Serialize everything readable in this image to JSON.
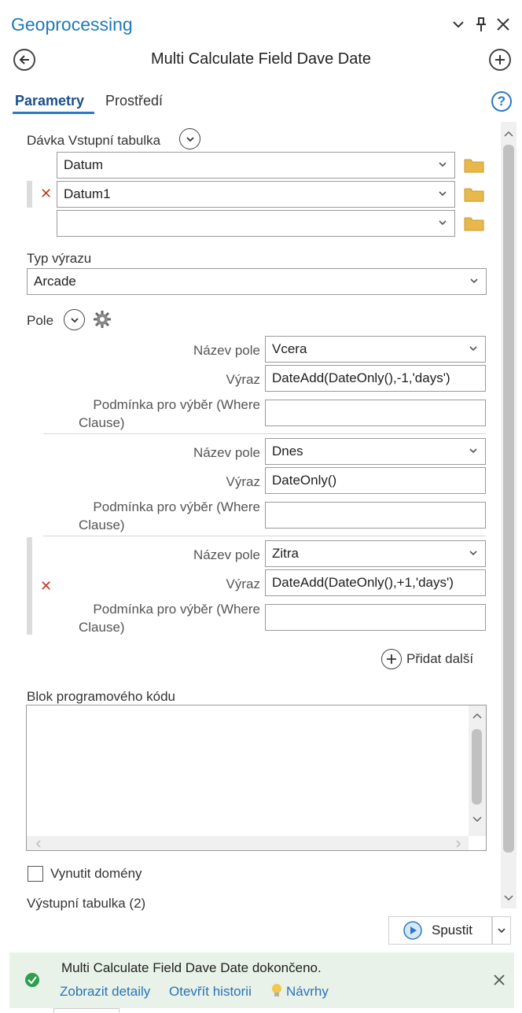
{
  "pane": {
    "title": "Geoprocessing"
  },
  "tool": {
    "title": "Multi Calculate Field Dave Date"
  },
  "tabs": [
    {
      "label": "Parametry"
    },
    {
      "label": "Prostředí"
    }
  ],
  "batch_input": {
    "label": "Dávka Vstupní tabulka",
    "rows": [
      {
        "value": "Datum"
      },
      {
        "value": "Datum1"
      },
      {
        "value": ""
      }
    ]
  },
  "expression_type": {
    "label": "Typ výrazu",
    "value": "Arcade"
  },
  "fields": {
    "label": "Pole",
    "name_label": "Název pole",
    "expr_label": "Výraz",
    "where_label_1": "Podmínka pro výběr (Where",
    "where_label_2": "Clause)",
    "groups": [
      {
        "name": "Vcera",
        "expression": "DateAdd(DateOnly(),-1,'days')",
        "where": ""
      },
      {
        "name": "Dnes",
        "expression": "DateOnly()",
        "where": ""
      },
      {
        "name": "Zitra",
        "expression": "DateAdd(DateOnly(),+1,'days')",
        "where": ""
      }
    ],
    "add_more": "Přidat další"
  },
  "code_block": {
    "label": "Blok programového kódu",
    "value": ""
  },
  "enforce_domains": {
    "label": "Vynutit domény",
    "checked": false
  },
  "output_table": {
    "label": "Výstupní tabulka (2)"
  },
  "run_button": {
    "label": "Spustit"
  },
  "status": {
    "message": "Multi Calculate Field Dave Date dokončeno.",
    "links": [
      "Zobrazit detaily",
      "Otevřít historii",
      "Návrhy"
    ]
  },
  "colors": {
    "accent": "#2b79c2",
    "success": "#2e9e4f",
    "remove": "#c0392b",
    "folder": "#e8b84a",
    "banner_bg": "#e8f2e8"
  }
}
